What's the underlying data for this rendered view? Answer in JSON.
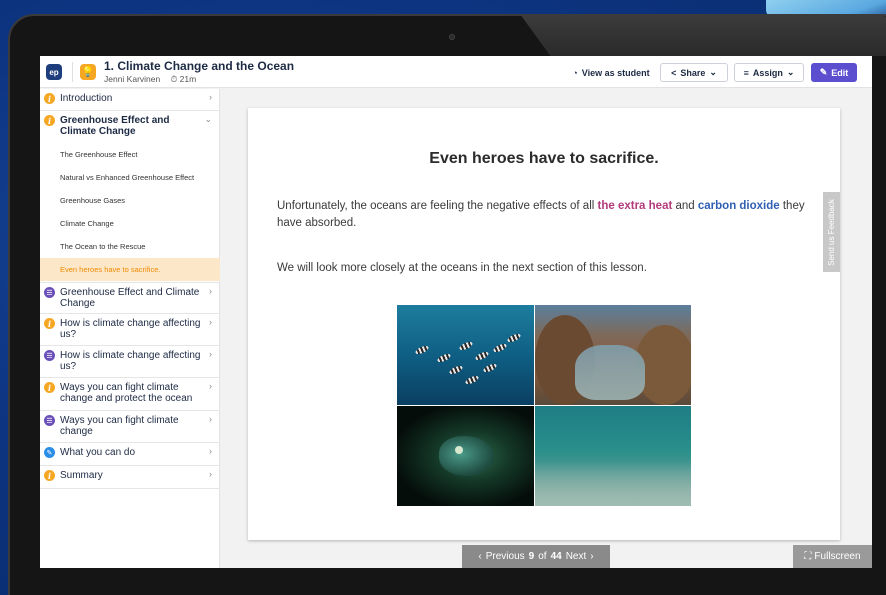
{
  "header": {
    "logo_text": "ep",
    "lesson_title": "1. Climate Change and the Ocean",
    "author": "Jenni Karvinen",
    "duration": "21m",
    "view_as_student": "View as student",
    "share": "Share",
    "assign": "Assign",
    "edit": "Edit"
  },
  "sidebar": {
    "items": [
      {
        "type": "info",
        "label": "Introduction",
        "chevron": "right"
      },
      {
        "type": "info",
        "label": "Greenhouse Effect and Climate Change",
        "chevron": "down",
        "expanded": true
      },
      {
        "type": "quiz",
        "label": "Greenhouse Effect and Climate Change",
        "chevron": "right"
      },
      {
        "type": "info",
        "label": "How is climate change affecting us?",
        "chevron": "right"
      },
      {
        "type": "quiz",
        "label": "How is climate change affecting us?",
        "chevron": "right"
      },
      {
        "type": "info",
        "label": "Ways you can fight climate change and protect the ocean",
        "chevron": "right"
      },
      {
        "type": "quiz",
        "label": "Ways you can fight climate change",
        "chevron": "right"
      },
      {
        "type": "task",
        "label": "What you can do",
        "chevron": "right"
      },
      {
        "type": "info",
        "label": "Summary",
        "chevron": "right"
      }
    ],
    "subitems": [
      {
        "label": "The Greenhouse Effect",
        "active": false
      },
      {
        "label": "Natural vs Enhanced Greenhouse Effect",
        "active": false
      },
      {
        "label": "Greenhouse Gases",
        "active": false
      },
      {
        "label": "Climate Change",
        "active": false
      },
      {
        "label": "The Ocean to the Rescue",
        "active": false
      },
      {
        "label": "Even heroes have to sacrifice.",
        "active": true
      }
    ]
  },
  "content": {
    "title": "Even heroes have to sacrifice.",
    "para1_a": "Unfortunately, the oceans are feeling the negative effects of all ",
    "para1_hl1": "the extra heat",
    "para1_b": " and ",
    "para1_hl2": "carbon dioxide",
    "para1_c": " they have absorbed.",
    "para2": "We will look more closely at the oceans in the next section of this lesson.",
    "feedback_tab": "Send us Feedback"
  },
  "footer": {
    "previous": "Previous",
    "current_page": "9",
    "of": "of",
    "total_pages": "44",
    "next": "Next",
    "fullscreen": "Fullscreen"
  },
  "colors": {
    "accent_purple": "#5b4fcf",
    "info_orange": "#f5a623",
    "quiz_purple": "#6a4fb8",
    "highlight_red": "#b23a7a",
    "highlight_blue": "#2f5fb3",
    "active_bg": "#fde7c9"
  },
  "icons": {
    "view": "user-circle-icon",
    "share": "share-icon",
    "assign": "assign-list-icon",
    "edit": "pencil-icon",
    "clock": "clock-icon",
    "bulb": "lightbulb-icon"
  }
}
